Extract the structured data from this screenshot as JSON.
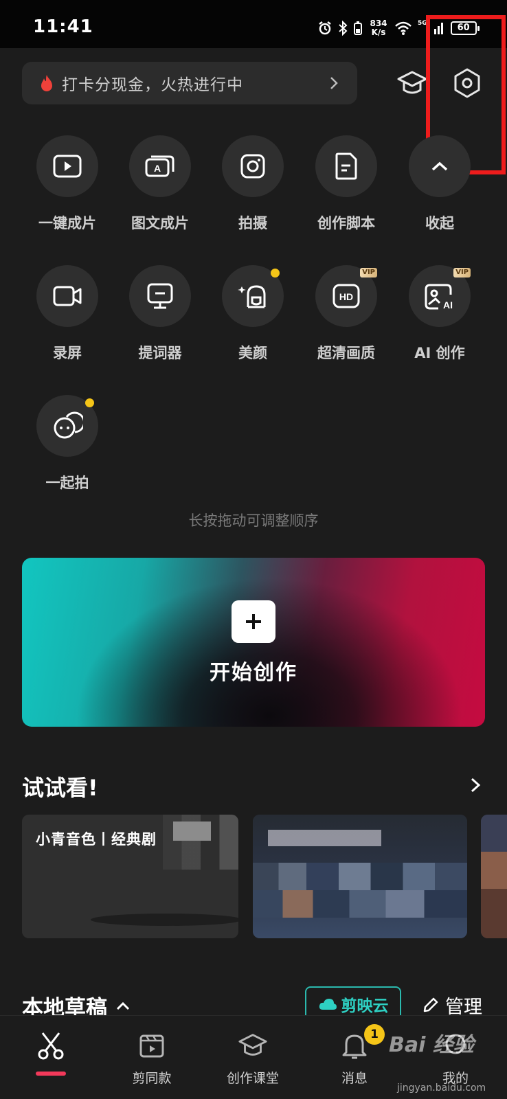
{
  "status_bar": {
    "time": "11:41",
    "net_speed": "834 K/s",
    "network": "5G",
    "battery": "60"
  },
  "header": {
    "promo_text": "打卡分现金，火热进行中",
    "icons": [
      "fire-icon",
      "chevron-right-icon",
      "graduation-cap-icon",
      "settings-hexagon-icon"
    ]
  },
  "tools": [
    {
      "label": "一键成片",
      "icon": "play-video-icon"
    },
    {
      "label": "图文成片",
      "icon": "text-to-video-icon"
    },
    {
      "label": "拍摄",
      "icon": "camera-icon"
    },
    {
      "label": "创作脚本",
      "icon": "script-document-icon"
    },
    {
      "label": "收起",
      "icon": "chevron-up-icon"
    },
    {
      "label": "录屏",
      "icon": "screen-record-icon"
    },
    {
      "label": "提词器",
      "icon": "teleprompter-icon"
    },
    {
      "label": "美颜",
      "icon": "beauty-icon",
      "dot": true
    },
    {
      "label": "超清画质",
      "icon": "hd-icon",
      "vip": "VIP"
    },
    {
      "label": "AI 创作",
      "icon": "ai-create-icon",
      "vip": "VIP"
    },
    {
      "label": "一起拍",
      "icon": "shoot-together-icon",
      "dot": true
    }
  ],
  "hint": "长按拖动可调整顺序",
  "create": {
    "label": "开始创作"
  },
  "try_section": {
    "title": "试试看!",
    "card1_title": "小青音色丨经典剧"
  },
  "drafts": {
    "title": "本地草稿",
    "cloud_label": "剪映云",
    "manage_label": "管理"
  },
  "bottom_nav": [
    {
      "label": "",
      "icon": "scissors-icon",
      "active": true
    },
    {
      "label": "剪同款",
      "icon": "template-clapper-icon"
    },
    {
      "label": "创作课堂",
      "icon": "graduation-cap-icon"
    },
    {
      "label": "消息",
      "icon": "bell-icon",
      "badge": "1"
    },
    {
      "label": "我的",
      "icon": "profile-icon"
    }
  ],
  "watermark": {
    "brand": "Bai 经验",
    "url": "jingyan.baidu.com"
  },
  "colors": {
    "background": "#1c1c1c",
    "accent_red": "#f2395a",
    "cloud_teal": "#2ed0c3",
    "badge_yellow": "#f5c518",
    "highlight_red": "#ee1c1c"
  }
}
